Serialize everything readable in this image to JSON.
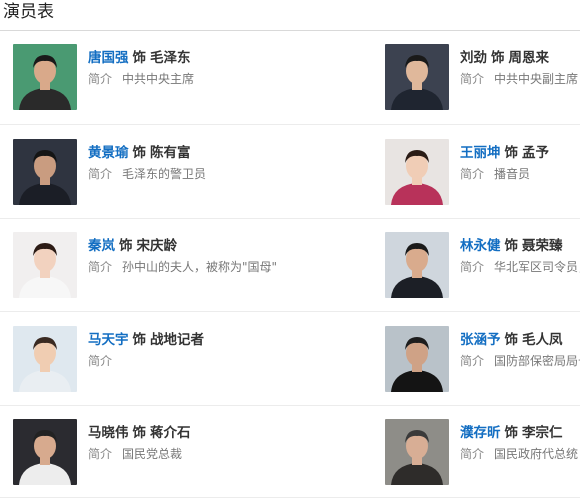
{
  "section_title": "演员表",
  "intro_label": "简介",
  "shi": "饰",
  "cast": [
    {
      "actor": "唐国强",
      "role": "毛泽东",
      "desc": "中共中央主席",
      "link": true,
      "bg": "#4a9a72",
      "skin": "#d9a98a",
      "cloth": "#2a2a2a",
      "hair": "#1a1a1a"
    },
    {
      "actor": "刘劲",
      "role": "周恩来",
      "desc": "中共中央副主席",
      "link": false,
      "bg": "#3c4250",
      "skin": "#e0b89b",
      "cloth": "#1f2530",
      "hair": "#1a1a1a"
    },
    {
      "actor": "黄景瑜",
      "role": "陈有富",
      "desc": "毛泽东的警卫员",
      "link": true,
      "bg": "#2f3440",
      "skin": "#c99c80",
      "cloth": "#1b1e26",
      "hair": "#151515"
    },
    {
      "actor": "王丽坤",
      "role": "孟予",
      "desc": "播音员",
      "link": true,
      "bg": "#e8e4e2",
      "skin": "#f0cdb6",
      "cloth": "#b8325a",
      "hair": "#2a1c16"
    },
    {
      "actor": "秦岚",
      "role": "宋庆龄",
      "desc": "孙中山的夫人，被称为\"国母\"",
      "link": true,
      "bg": "#f1efef",
      "skin": "#f2d2bf",
      "cloth": "#f7f7f7",
      "hair": "#2c1b15"
    },
    {
      "actor": "林永健",
      "role": "聂荣臻",
      "desc": "华北军区司令员，",
      "link": true,
      "bg": "#cfd6dd",
      "skin": "#d9ab8d",
      "cloth": "#1c1f26",
      "hair": "#1a1a1a"
    },
    {
      "actor": "马天宇",
      "role": "战地记者",
      "desc": "",
      "link": true,
      "bg": "#dfe8ef",
      "skin": "#f0cdb2",
      "cloth": "#e9eef2",
      "hair": "#3a2a22"
    },
    {
      "actor": "张涵予",
      "role": "毛人凤",
      "desc": "国防部保密局局长",
      "link": true,
      "bg": "#b9c2c9",
      "skin": "#cfa286",
      "cloth": "#141414",
      "hair": "#1d1d1d"
    },
    {
      "actor": "马晓伟",
      "role": "蒋介石",
      "desc": "国民党总裁",
      "link": false,
      "bg": "#2b2b30",
      "skin": "#d7aa8e",
      "cloth": "#ededed",
      "hair": "#222222"
    },
    {
      "actor": "濮存昕",
      "role": "李宗仁",
      "desc": "国民政府代总统",
      "link": true,
      "bg": "#8e8d88",
      "skin": "#d8ae95",
      "cloth": "#2e2c2a",
      "hair": "#3a3a3a"
    }
  ]
}
